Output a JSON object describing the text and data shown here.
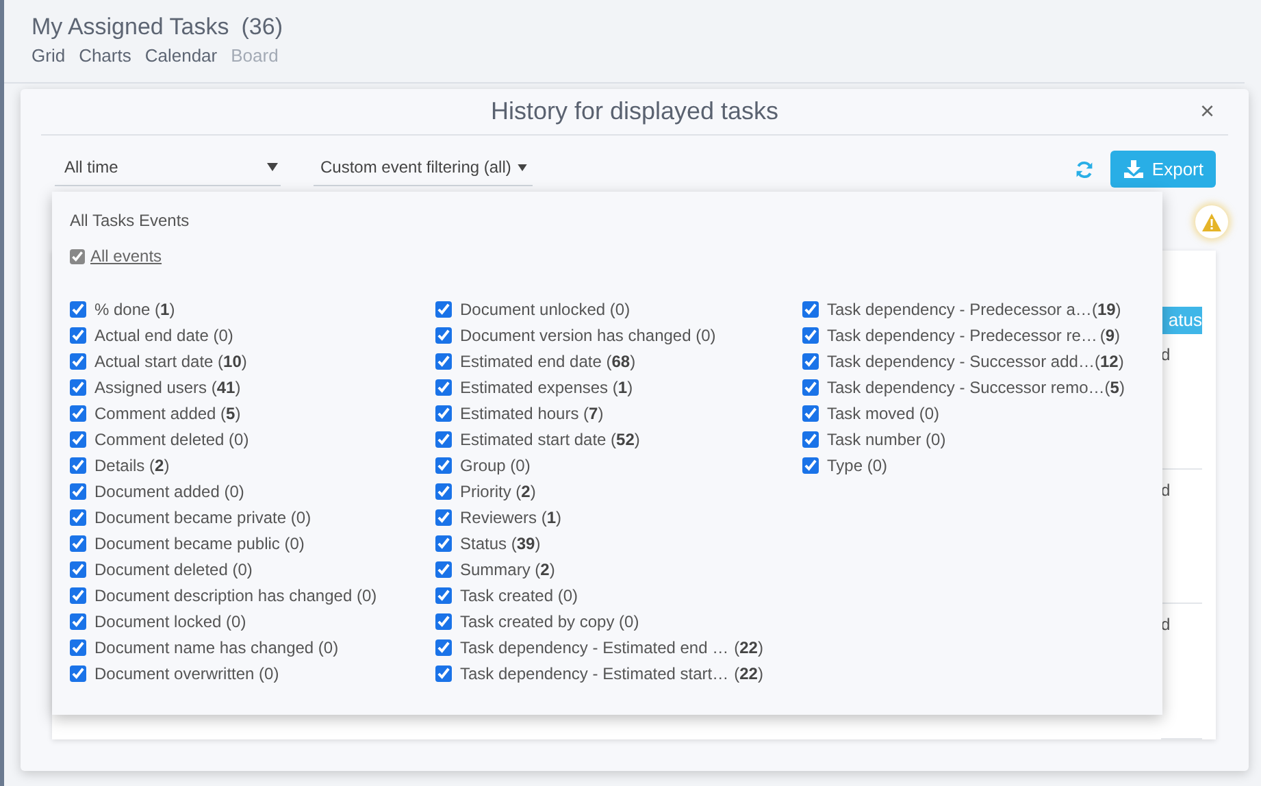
{
  "header": {
    "title": "My Assigned Tasks",
    "count": "(36)",
    "views": [
      {
        "label": "Grid",
        "disabled": false
      },
      {
        "label": "Charts",
        "disabled": false
      },
      {
        "label": "Calendar",
        "disabled": false
      },
      {
        "label": "Board",
        "disabled": true
      }
    ]
  },
  "modal": {
    "title": "History for displayed tasks",
    "close": "×",
    "period": "All time",
    "filter": "Custom event filtering (all)",
    "export": "Export"
  },
  "table": {
    "column_header": "atus",
    "cells": [
      "d",
      "d",
      "d"
    ]
  },
  "popup": {
    "heading": "All Tasks Events",
    "all_events": {
      "label": "All events",
      "checked": true
    },
    "columns": [
      [
        {
          "text": "% done (**1**)",
          "checked": true
        },
        {
          "text": "Actual end date (0)",
          "checked": true
        },
        {
          "text": "Actual start date (**10**)",
          "checked": true
        },
        {
          "text": "Assigned users (**41**)",
          "checked": true
        },
        {
          "text": "Comment added (**5**)",
          "checked": true
        },
        {
          "text": "Comment deleted (0)",
          "checked": true
        },
        {
          "text": "Details (**2**)",
          "checked": true
        },
        {
          "text": "Document added (0)",
          "checked": true
        },
        {
          "text": "Document became private (0)",
          "checked": true
        },
        {
          "text": "Document became public (0)",
          "checked": true
        },
        {
          "text": "Document deleted (0)",
          "checked": true
        },
        {
          "text": "Document description has changed (0)",
          "checked": true
        },
        {
          "text": "Document locked (0)",
          "checked": true
        },
        {
          "text": "Document name has changed (0)",
          "checked": true
        },
        {
          "text": "Document overwritten (0)",
          "checked": true
        }
      ],
      [
        {
          "text": "Document unlocked (0)",
          "checked": true
        },
        {
          "text": "Document version has changed (0)",
          "checked": true
        },
        {
          "text": "Estimated end date (**68**)",
          "checked": true
        },
        {
          "text": "Estimated expenses (**1**)",
          "checked": true
        },
        {
          "text": "Estimated hours (**7**)",
          "checked": true
        },
        {
          "text": "Estimated start date (**52**)",
          "checked": true
        },
        {
          "text": "Group (0)",
          "checked": true
        },
        {
          "text": "Priority (**2**)",
          "checked": true
        },
        {
          "text": "Reviewers (**1**)",
          "checked": true
        },
        {
          "text": "Status (**39**)",
          "checked": true
        },
        {
          "text": "Summary (**2**)",
          "checked": true
        },
        {
          "text": "Task created (0)",
          "checked": true
        },
        {
          "text": "Task created by copy (0)",
          "checked": true
        },
        {
          "text": "Task dependency - Estimated end …",
          "count": "(**22**)",
          "checked": true
        },
        {
          "text": "Task dependency - Estimated start…",
          "count": "(**22**)",
          "checked": true
        }
      ],
      [
        {
          "text": "Task dependency - Predecessor a…",
          "count": "(**19**)",
          "checked": true
        },
        {
          "text": "Task dependency - Predecessor re…",
          "count": "(**9**)",
          "checked": true
        },
        {
          "text": "Task dependency - Successor add…",
          "count": "(**12**)",
          "checked": true
        },
        {
          "text": "Task dependency - Successor remo…",
          "count": "(**5**)",
          "checked": true
        },
        {
          "text": "Task moved (0)",
          "checked": true
        },
        {
          "text": "Task number (0)",
          "checked": true
        },
        {
          "text": "Type (0)",
          "checked": true
        }
      ]
    ]
  }
}
